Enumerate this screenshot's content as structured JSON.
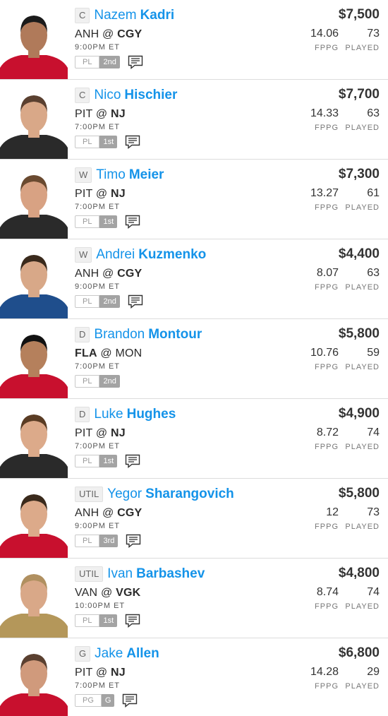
{
  "labels": {
    "fppg": "FPPG",
    "played": "PLAYED"
  },
  "players": [
    {
      "pos": "C",
      "first": "Nazem",
      "last": "Kadri",
      "away": "ANH",
      "at": "@",
      "home": "CGY",
      "bold_team": "home",
      "time": "9:00PM ET",
      "tag": "PL",
      "order": "2nd",
      "has_note": true,
      "price": "$7,500",
      "fppg": "14.06",
      "played": "73",
      "jersey": "#c8102e",
      "skin": "#b07a5a",
      "hair": "#1b1b1b"
    },
    {
      "pos": "C",
      "first": "Nico",
      "last": "Hischier",
      "away": "PIT",
      "at": "@",
      "home": "NJ",
      "bold_team": "home",
      "time": "7:00PM ET",
      "tag": "PL",
      "order": "1st",
      "has_note": true,
      "price": "$7,700",
      "fppg": "14.33",
      "played": "63",
      "jersey": "#2a2a2a",
      "skin": "#d9a888",
      "hair": "#5a4030"
    },
    {
      "pos": "W",
      "first": "Timo",
      "last": "Meier",
      "away": "PIT",
      "at": "@",
      "home": "NJ",
      "bold_team": "home",
      "time": "7:00PM ET",
      "tag": "PL",
      "order": "1st",
      "has_note": true,
      "price": "$7,300",
      "fppg": "13.27",
      "played": "61",
      "jersey": "#2a2a2a",
      "skin": "#d8a283",
      "hair": "#6a4a30"
    },
    {
      "pos": "W",
      "first": "Andrei",
      "last": "Kuzmenko",
      "away": "ANH",
      "at": "@",
      "home": "CGY",
      "bold_team": "home",
      "time": "9:00PM ET",
      "tag": "PL",
      "order": "2nd",
      "has_note": true,
      "price": "$4,400",
      "fppg": "8.07",
      "played": "63",
      "jersey": "#1f4e8c",
      "skin": "#d8a888",
      "hair": "#3a2a1c"
    },
    {
      "pos": "D",
      "first": "Brandon",
      "last": "Montour",
      "away": "FLA",
      "at": "@",
      "home": "MON",
      "bold_team": "away",
      "time": "7:00PM ET",
      "tag": "PL",
      "order": "2nd",
      "has_note": false,
      "price": "$5,800",
      "fppg": "10.76",
      "played": "59",
      "jersey": "#c8102e",
      "skin": "#b5805c",
      "hair": "#121212"
    },
    {
      "pos": "D",
      "first": "Luke",
      "last": "Hughes",
      "away": "PIT",
      "at": "@",
      "home": "NJ",
      "bold_team": "home",
      "time": "7:00PM ET",
      "tag": "PL",
      "order": "1st",
      "has_note": true,
      "price": "$4,900",
      "fppg": "8.72",
      "played": "74",
      "jersey": "#2a2a2a",
      "skin": "#dcaa8a",
      "hair": "#5a3c24"
    },
    {
      "pos": "UTIL",
      "first": "Yegor",
      "last": "Sharangovich",
      "away": "ANH",
      "at": "@",
      "home": "CGY",
      "bold_team": "home",
      "time": "9:00PM ET",
      "tag": "PL",
      "order": "3rd",
      "has_note": true,
      "price": "$5,800",
      "fppg": "12",
      "played": "73",
      "jersey": "#c8102e",
      "skin": "#dcaa8a",
      "hair": "#3a2a1c"
    },
    {
      "pos": "UTIL",
      "first": "Ivan",
      "last": "Barbashev",
      "away": "VAN",
      "at": "@",
      "home": "VGK",
      "bold_team": "home",
      "time": "10:00PM ET",
      "tag": "PL",
      "order": "1st",
      "has_note": true,
      "price": "$4,800",
      "fppg": "8.74",
      "played": "74",
      "jersey": "#b4975a",
      "skin": "#d9a888",
      "hair": "#b09060"
    },
    {
      "pos": "G",
      "first": "Jake",
      "last": "Allen",
      "away": "PIT",
      "at": "@",
      "home": "NJ",
      "bold_team": "home",
      "time": "7:00PM ET",
      "tag": "PG",
      "order": "G",
      "has_note": true,
      "price": "$6,800",
      "fppg": "14.28",
      "played": "29",
      "jersey": "#c8102e",
      "skin": "#d09a7c",
      "hair": "#5a4030"
    }
  ]
}
